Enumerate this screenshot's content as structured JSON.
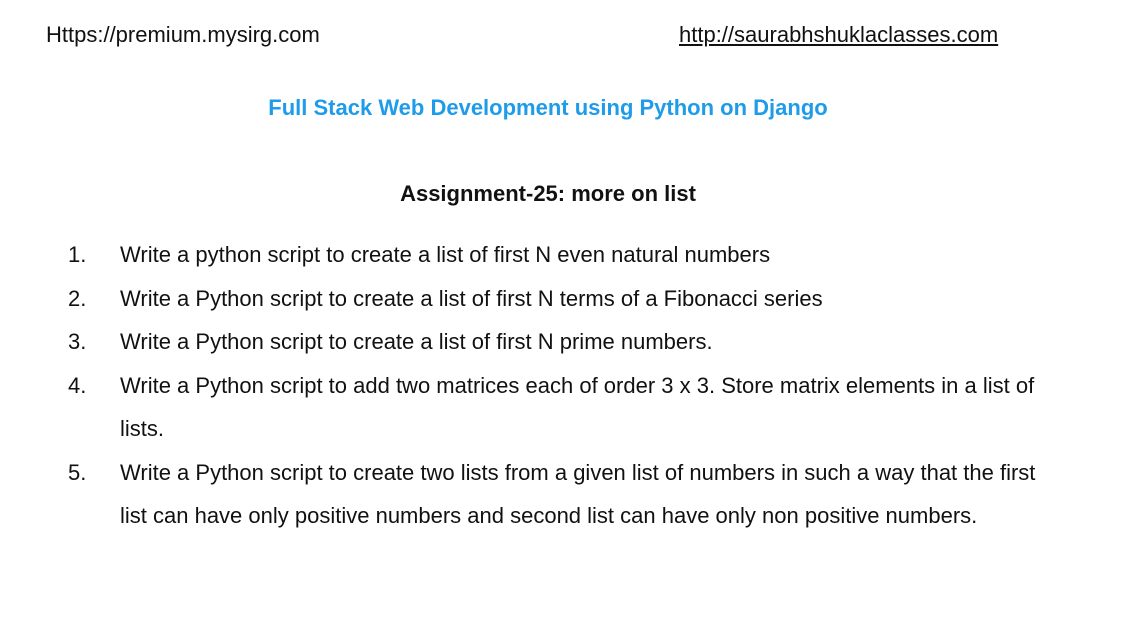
{
  "header": {
    "left_link": "Https://premium.mysirg.com",
    "right_link": "http://saurabhshuklaclasses.com"
  },
  "course_title": "Full Stack Web Development using Python on Django",
  "assignment_title": "Assignment-25: more on list",
  "colors": {
    "course_title": "#1e9be9",
    "text": "#111111",
    "background": "#ffffff"
  },
  "tasks": [
    {
      "num": "1.",
      "text": "Write a python script to create a list of first N even natural numbers"
    },
    {
      "num": "2.",
      "text": "Write a Python script to create a list of first N terms of a Fibonacci series"
    },
    {
      "num": "3.",
      "text": "Write a Python script to create a list of first N prime numbers."
    },
    {
      "num": "4.",
      "text": "Write a Python script to add two matrices each of order 3 x 3. Store matrix elements in a list of lists."
    },
    {
      "num": "5.",
      "text": "Write a Python script to create two lists from a given list of numbers in such a way that the first list can have only positive numbers and second list can have only non positive numbers."
    }
  ]
}
